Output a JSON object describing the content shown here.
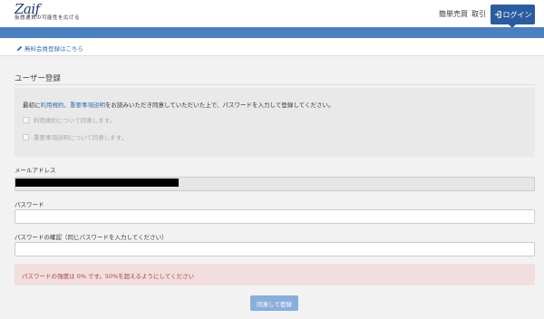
{
  "header": {
    "logo_text": "Zaif",
    "logo_tagline": "仮想通貨の可能性を広げる",
    "nav": [
      "簡単売買",
      "取引"
    ],
    "login_label": "ログイン",
    "login_icon": "sign-in-icon"
  },
  "register_link": {
    "icon": "pencil-icon",
    "label": "無料会員登録はこちら"
  },
  "form": {
    "title": "ユーザー登録",
    "agreement": {
      "prefix": "最初に",
      "link_terms": "利用規約",
      "separator": "、",
      "link_disclosure": "重要事項説明",
      "suffix": "をお読みいただき同意していただいた上で、パスワードを入力して登録してください。",
      "checkbox_terms": "利用規約について同意します。",
      "checkbox_disclosure": "重要事項説明について同意します。"
    },
    "email_label": "メールアドレス",
    "password_label": "パスワード",
    "password_confirm_label": "パスワードの確認（同じパスワードを入力してください）",
    "strength_message": "パスワードの強度は 0% です。50%を超えるようにしてください",
    "submit_label": "同意して登録"
  },
  "colors": {
    "brand": "#2b5c9f",
    "band": "#4a7fc0",
    "link": "#3a6fb5",
    "alert_bg": "#f2dede",
    "alert_text": "#a94442",
    "submit_disabled": "#8aaedb"
  }
}
